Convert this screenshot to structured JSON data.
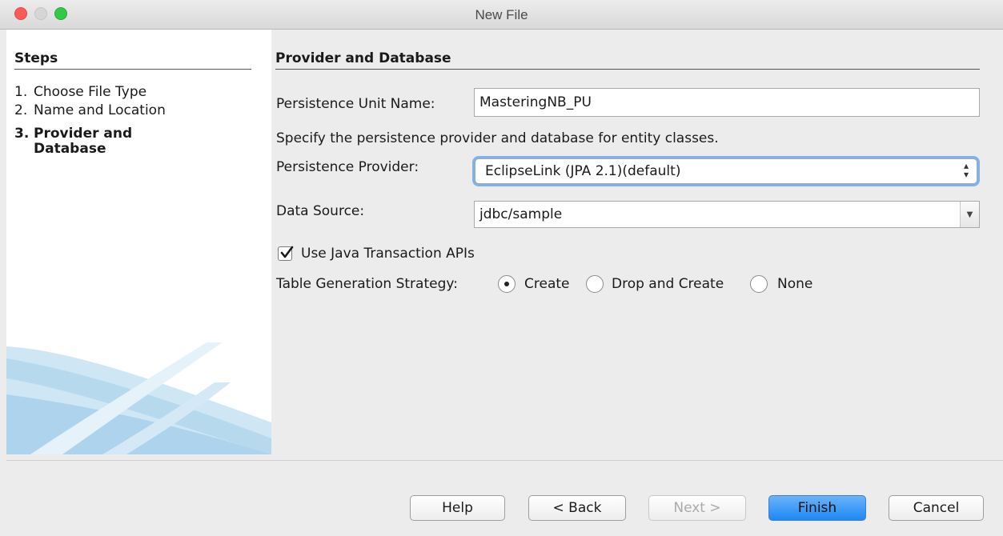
{
  "window": {
    "title": "New File"
  },
  "steps": {
    "title": "Steps",
    "items": [
      {
        "num": "1.",
        "label": "Choose File Type"
      },
      {
        "num": "2.",
        "label": "Name and Location"
      },
      {
        "num": "3.",
        "label": "Provider and",
        "label_cont": "Database"
      }
    ]
  },
  "main": {
    "section_title": "Provider and Database",
    "pu_name_label": "Persistence Unit Name:",
    "pu_name_value": "MasteringNB_PU",
    "description": "Specify the persistence provider and database for entity classes.",
    "provider_label": "Persistence Provider:",
    "provider_value": "EclipseLink (JPA 2.1)(default)",
    "datasource_label": "Data Source:",
    "datasource_value": "jdbc/sample",
    "jta_label": "Use Java Transaction APIs",
    "jta_checked": true,
    "strategy_label": "Table Generation Strategy:",
    "strategy_options": [
      "Create",
      "Drop and Create",
      "None"
    ],
    "strategy_selected": "Create"
  },
  "buttons": {
    "help": "Help",
    "back": "< Back",
    "next": "Next >",
    "finish": "Finish",
    "cancel": "Cancel"
  },
  "colors": {
    "accent": "#1d88f5",
    "focus_ring": "#7fb1ec"
  }
}
